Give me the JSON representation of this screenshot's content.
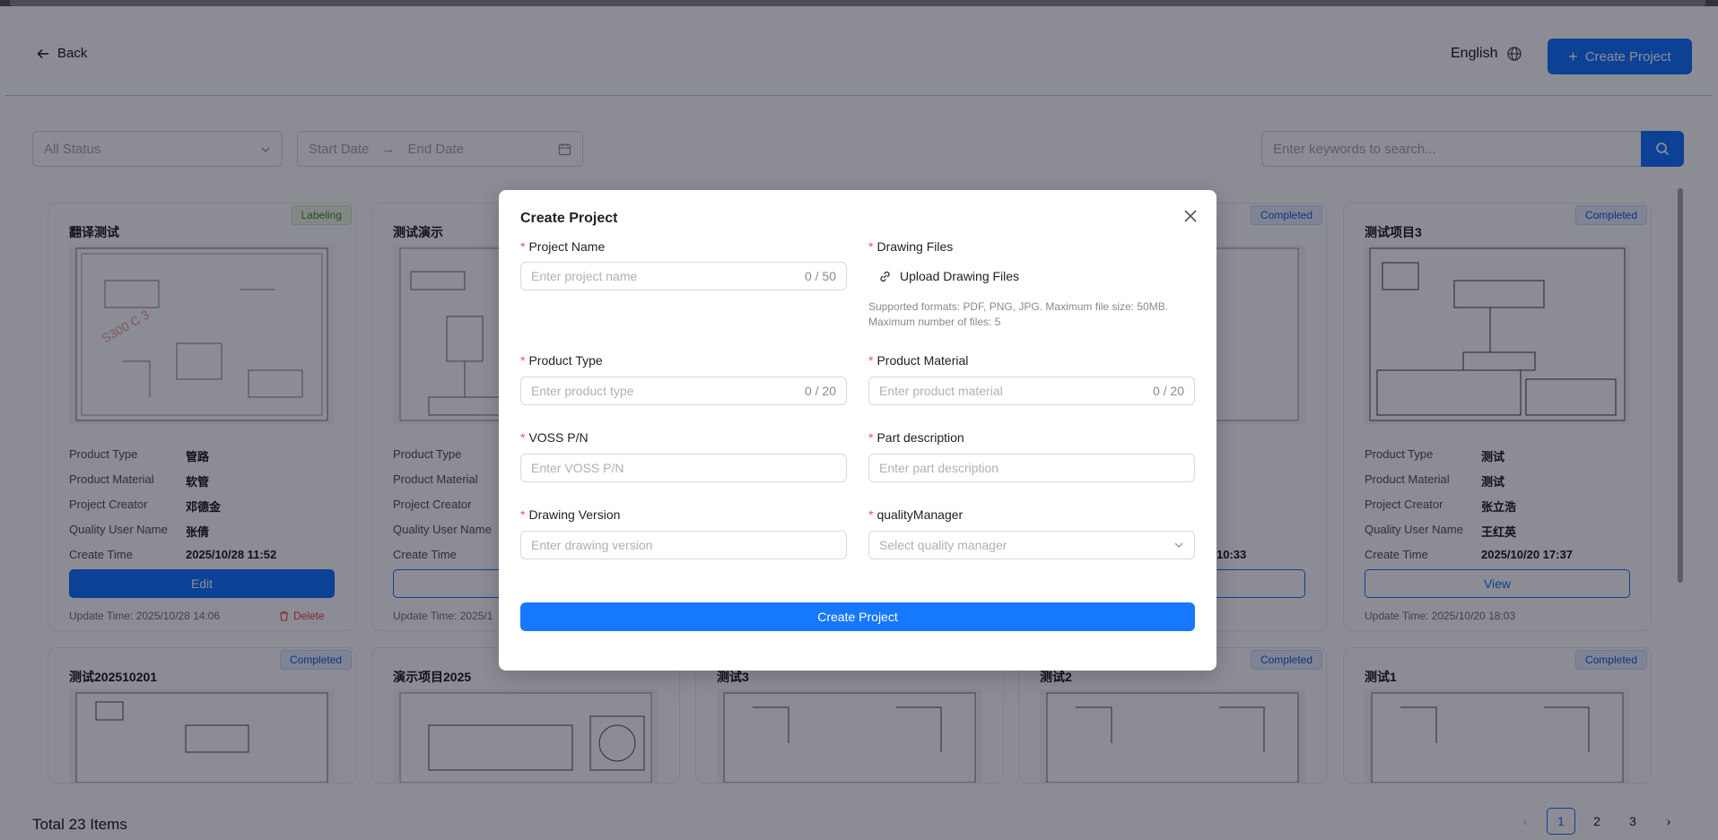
{
  "header": {
    "back_label": "Back",
    "language_label": "English",
    "create_label": "Create Project"
  },
  "filters": {
    "status_placeholder": "All Status",
    "start_date_placeholder": "Start Date",
    "end_date_placeholder": "End Date",
    "search_placeholder": "Enter keywords to search..."
  },
  "field_labels": {
    "product_type": "Product Type",
    "product_material": "Product Material",
    "project_creator": "Project Creator",
    "quality_user": "Quality User Name",
    "create_time": "Create Time"
  },
  "cards": [
    {
      "title": "翻译测试",
      "status": "Labeling",
      "product_type": "管路",
      "product_material": "软管",
      "project_creator": "邓德金",
      "quality_user": "张倩",
      "create_time": "2025/10/28 11:52",
      "action": "Edit",
      "update_time": "Update Time: 2025/10/28 14:06",
      "delete_label": "Delete"
    },
    {
      "title": "测试演示",
      "status": "",
      "action": "",
      "update_time": "Update Time: 2025/1"
    },
    {
      "status": "Completed",
      "create_time_partial": "10:33"
    },
    {
      "title": "测试项目3",
      "status": "Completed",
      "product_type": "测试",
      "product_material": "测试",
      "project_creator": "张立浩",
      "quality_user": "王红英",
      "create_time": "2025/10/20 17:37",
      "action": "View",
      "update_time": "Update Time: 2025/10/20 18:03"
    }
  ],
  "cards_row2": [
    {
      "title": "测试202510201",
      "status": "Completed"
    },
    {
      "title": "演示项目2025",
      "status": ""
    },
    {
      "title": "测试3",
      "status": ""
    },
    {
      "title": "测试2",
      "status": "Completed"
    },
    {
      "title": "测试1",
      "status": "Completed"
    }
  ],
  "footer": {
    "total": "Total 23 Items",
    "pages": [
      "1",
      "2",
      "3"
    ],
    "current_page": "1"
  },
  "modal": {
    "title": "Create Project",
    "project_name": {
      "label": "Project Name",
      "placeholder": "Enter project name",
      "count": "0 / 50"
    },
    "drawing_files": {
      "label": "Drawing Files",
      "upload_label": "Upload Drawing Files",
      "hint": "Supported formats: PDF, PNG, JPG. Maximum file size: 50MB. Maximum number of files: 5"
    },
    "product_type": {
      "label": "Product Type",
      "placeholder": "Enter product type",
      "count": "0 / 20"
    },
    "product_material": {
      "label": "Product Material",
      "placeholder": "Enter product material",
      "count": "0 / 20"
    },
    "voss_pn": {
      "label": "VOSS P/N",
      "placeholder": "Enter VOSS P/N"
    },
    "part_description": {
      "label": "Part description",
      "placeholder": "Enter part description"
    },
    "drawing_version": {
      "label": "Drawing Version",
      "placeholder": "Enter drawing version"
    },
    "quality_manager": {
      "label": "qualityManager",
      "placeholder": "Select quality manager"
    },
    "submit_label": "Create Project",
    "required_mark": "*"
  },
  "colors": {
    "primary": "#1677ff",
    "danger": "#ff4d4f",
    "overlay": "rgba(0,0,20,0.45)"
  }
}
